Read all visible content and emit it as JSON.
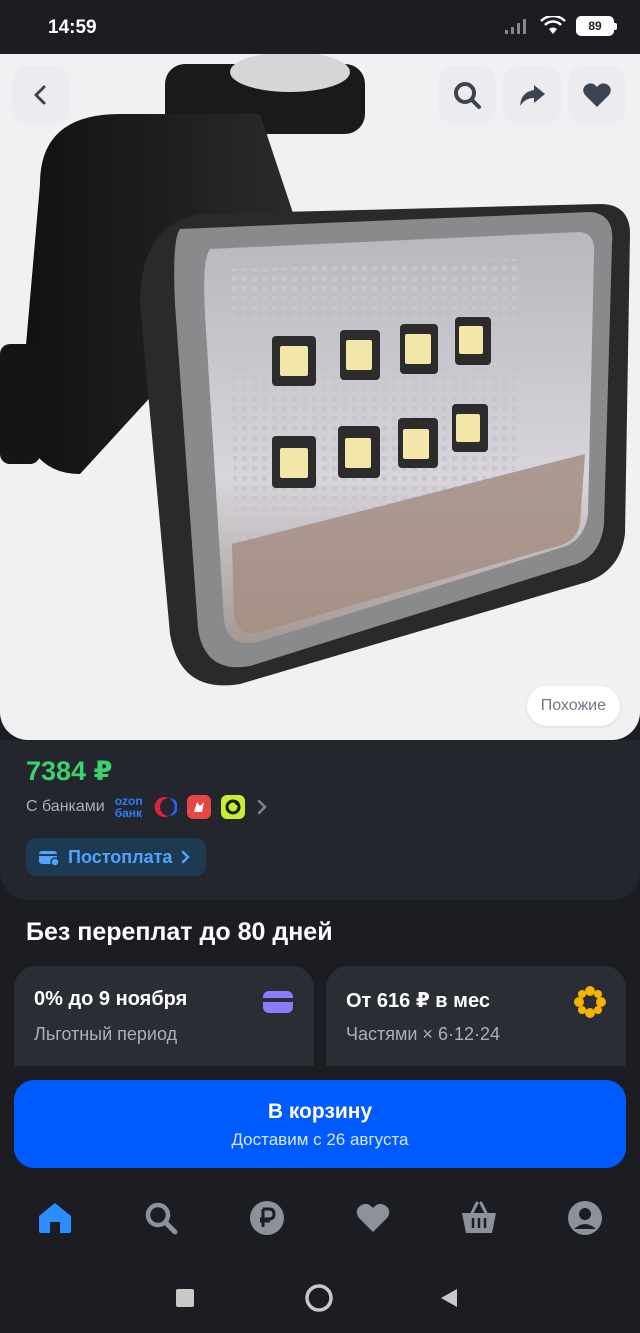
{
  "status_bar": {
    "time": "14:59",
    "battery": "89"
  },
  "hero": {
    "similar_label": "Похожие"
  },
  "product": {
    "price": "7384 ₽",
    "banks_label": "С банками",
    "ozon_bank_top": "ozon",
    "ozon_bank_bottom": "банк",
    "postpay_label": "Постоплата"
  },
  "installments": {
    "title": "Без переплат до 80 дней",
    "offers": [
      {
        "title": "0% до 9 ноября",
        "subtitle": "Льготный период"
      },
      {
        "title": "От 616 ₽ в мес",
        "subtitle": "Частями × 6·12·24"
      }
    ]
  },
  "cart": {
    "title": "В корзину",
    "subtitle": "Доставим с 26 августа"
  },
  "colors": {
    "accent": "#005bff",
    "price": "#3dd16e",
    "background": "#1b1d22",
    "card": "#23262c"
  }
}
